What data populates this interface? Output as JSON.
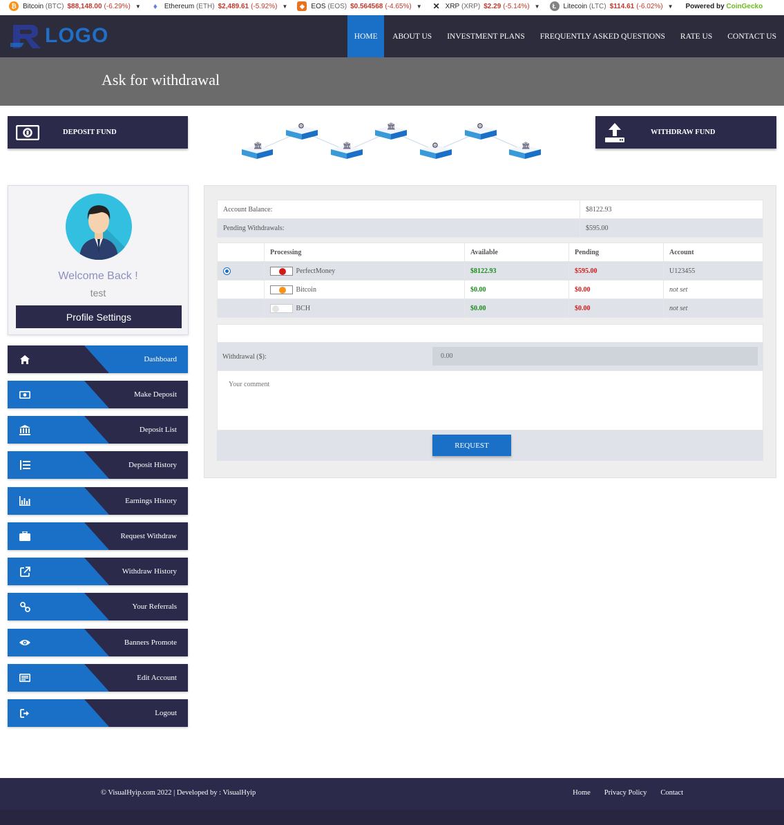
{
  "ticker": {
    "coins": [
      {
        "name": "Bitcoin",
        "symbol": "(BTC)",
        "price": "$88,148.00",
        "change": "(-6.29%)",
        "icon": "bitcoin-icon",
        "color": "#f7931a",
        "glyph": "₿"
      },
      {
        "name": "Ethereum",
        "symbol": "(ETH)",
        "price": "$2,489.61",
        "change": "(-5.92%)",
        "icon": "ethereum-icon",
        "color": "#627eea",
        "glyph": "♦"
      },
      {
        "name": "EOS",
        "symbol": "(EOS)",
        "price": "$0.564568",
        "change": "(-4.65%)",
        "icon": "eos-icon",
        "color": "#e8731c",
        "glyph": "◆"
      },
      {
        "name": "XRP",
        "symbol": "(XRP)",
        "price": "$2.29",
        "change": "(-5.14%)",
        "icon": "xrp-icon",
        "color": "#23292f",
        "glyph": "✕"
      },
      {
        "name": "Litecoin",
        "symbol": "(LTC)",
        "price": "$114.61",
        "change": "(-6.02%)",
        "icon": "litecoin-icon",
        "color": "#838383",
        "glyph": "Ł"
      }
    ],
    "powered_by": "Powered by",
    "powered_brand": "CoinGecko"
  },
  "logo": {
    "text": "LOGO"
  },
  "nav": {
    "items": [
      "HOME",
      "ABOUT US",
      "INVESTMENT PLANS",
      "FREQUENTLY ASKED QUESTIONS",
      "RATE US",
      "CONTACT US"
    ]
  },
  "page": {
    "title": "Ask for withdrawal"
  },
  "buttons": {
    "deposit": "DEPOSIT FUND",
    "withdraw": "WITHDRAW FUND"
  },
  "profile": {
    "welcome": "Welcome Back !",
    "username": "test",
    "settings_label": "Profile Settings"
  },
  "sidebar": {
    "items": [
      {
        "label": "Dashboard",
        "icon": "home-icon"
      },
      {
        "label": "Make Deposit",
        "icon": "money-icon"
      },
      {
        "label": "Deposit List",
        "icon": "bank-icon"
      },
      {
        "label": "Deposit History",
        "icon": "list-icon"
      },
      {
        "label": "Earnings History",
        "icon": "bar-chart-icon"
      },
      {
        "label": "Request Withdraw",
        "icon": "briefcase-icon"
      },
      {
        "label": "Withdraw History",
        "icon": "external-link-icon"
      },
      {
        "label": "Your Referrals",
        "icon": "link-icon"
      },
      {
        "label": "Banners Promote",
        "icon": "eye-icon"
      },
      {
        "label": "Edit Account",
        "icon": "id-card-icon"
      },
      {
        "label": "Logout",
        "icon": "sign-out-icon"
      }
    ]
  },
  "balance": {
    "account_label": "Account Balance:",
    "account_value": "$8122.93",
    "pending_label": "Pending Withdrawals:",
    "pending_value": "$595.00"
  },
  "processing": {
    "headers": [
      "Processing",
      "Available",
      "Pending",
      "Account"
    ],
    "rows": [
      {
        "name": "PerfectMoney",
        "available": "$8122.93",
        "pending": "$595.00",
        "account": "U123455",
        "selected": true,
        "logo_color": "#d11a1a"
      },
      {
        "name": "Bitcoin",
        "available": "$0.00",
        "pending": "$0.00",
        "account": "not set",
        "selected": false,
        "logo_color": "#f7931a"
      },
      {
        "name": "BCH",
        "available": "$0.00",
        "pending": "$0.00",
        "account": "not set",
        "selected": false,
        "logo_color": "#dddddd"
      }
    ]
  },
  "withdraw_form": {
    "amount_label": "Withdrawal ($):",
    "amount_value": "0.00",
    "comment_placeholder": "Your comment",
    "request_label": "REQUEST"
  },
  "footer": {
    "copyright": "© VisualHyip.com 2022 | Developed by : VisualHyip",
    "links": [
      "Home",
      "Privacy Policy",
      "Contact"
    ]
  },
  "colors": {
    "primary": "#1a6fc7",
    "dark": "#2c2a4b",
    "available": "#1a8c1a",
    "pending": "#d11a1a"
  }
}
